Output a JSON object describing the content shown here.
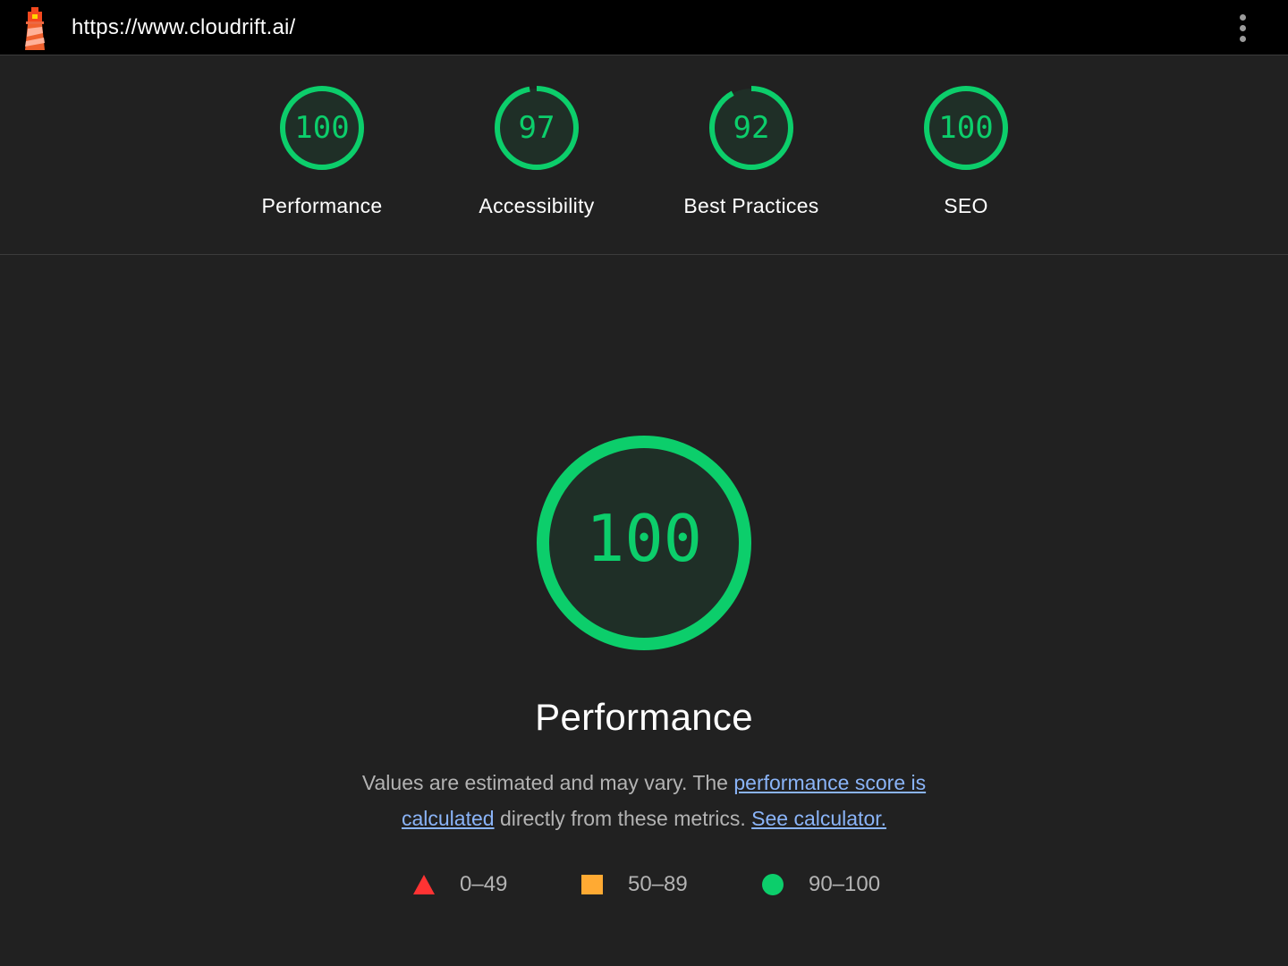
{
  "topbar": {
    "url": "https://www.cloudrift.ai/",
    "logo_icon": "lighthouse-icon",
    "menu_icon": "more-vert-icon"
  },
  "colors": {
    "pass": "#0cce6b",
    "pass_fill": "#1f2f27",
    "average": "#ffaa33",
    "fail": "#ff3333",
    "link": "#8ab4f8"
  },
  "categories": [
    {
      "label": "Performance",
      "score": 100
    },
    {
      "label": "Accessibility",
      "score": 97
    },
    {
      "label": "Best Practices",
      "score": 92
    },
    {
      "label": "SEO",
      "score": 100
    }
  ],
  "main": {
    "score": 100,
    "title": "Performance",
    "description_prefix": "Values are estimated and may vary. The ",
    "link_score": "performance score is calculated",
    "description_middle": " directly from these metrics. ",
    "link_calculator": "See calculator."
  },
  "legend": [
    {
      "shape": "triangle",
      "range": "0–49"
    },
    {
      "shape": "square",
      "range": "50–89"
    },
    {
      "shape": "circle",
      "range": "90–100"
    }
  ]
}
